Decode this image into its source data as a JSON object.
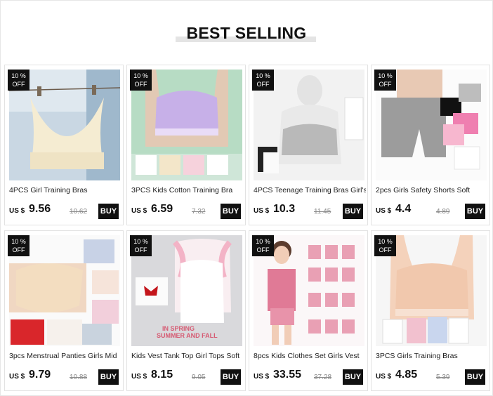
{
  "section_title": "BEST SELLING",
  "products": [
    {
      "badge_pct": "10 %",
      "badge_off": "OFF",
      "title": "4PCS Girl Training Bras",
      "currency": "US $",
      "price": "9.56",
      "old_price": "10.62",
      "buy": "BUY"
    },
    {
      "badge_pct": "10 %",
      "badge_off": "OFF",
      "title": "3PCS Kids Cotton Training Bra",
      "currency": "US $",
      "price": "6.59",
      "old_price": "7.32",
      "buy": "BUY"
    },
    {
      "badge_pct": "10 %",
      "badge_off": "OFF",
      "title": "4PCS Teenage Training Bras Girl's",
      "currency": "US $",
      "price": "10.3",
      "old_price": "11.45",
      "buy": "BUY"
    },
    {
      "badge_pct": "10 %",
      "badge_off": "OFF",
      "title": "2pcs Girls Safety Shorts Soft",
      "currency": "US $",
      "price": "4.4",
      "old_price": "4.89",
      "buy": "BUY"
    },
    {
      "badge_pct": "10 %",
      "badge_off": "OFF",
      "title": "3pcs Menstrual Panties Girls Mid",
      "currency": "US $",
      "price": "9.79",
      "old_price": "10.88",
      "buy": "BUY"
    },
    {
      "badge_pct": "10 %",
      "badge_off": "OFF",
      "title": "Kids Vest Tank Top Girl Tops Soft",
      "currency": "US $",
      "price": "8.15",
      "old_price": "9.05",
      "buy": "BUY",
      "image_text": [
        "IN SPRING",
        "SUMMER AND FALL"
      ]
    },
    {
      "badge_pct": "10 %",
      "badge_off": "OFF",
      "title": "8pcs Kids Clothes Set Girls Vest",
      "currency": "US $",
      "price": "33.55",
      "old_price": "37.28",
      "buy": "BUY"
    },
    {
      "badge_pct": "10 %",
      "badge_off": "OFF",
      "title": "3PCS Girls Training Bras",
      "currency": "US $",
      "price": "4.85",
      "old_price": "5.39",
      "buy": "BUY"
    }
  ],
  "colors": {
    "badge_bg": "#111111",
    "buy_bg": "#000000",
    "title_bar": "#e4e4e4"
  }
}
